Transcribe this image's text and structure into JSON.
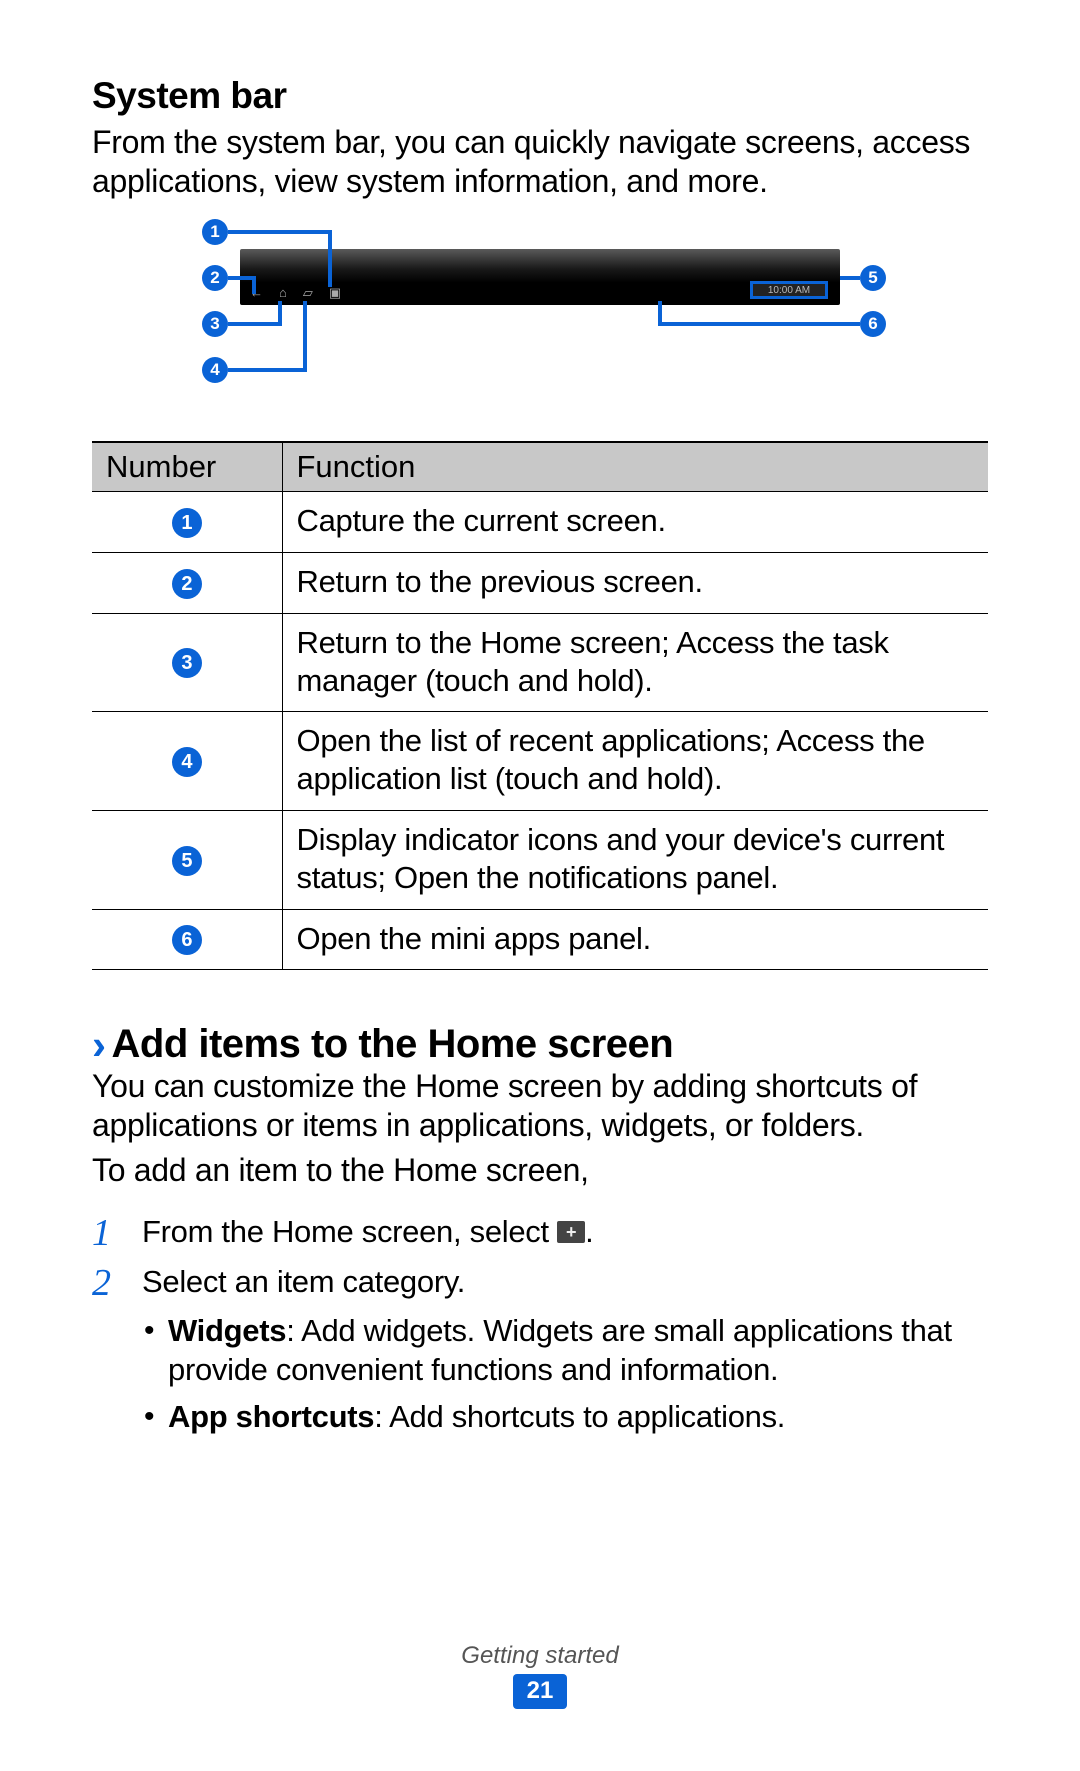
{
  "section1": {
    "title": "System bar",
    "intro": "From the system bar, you can quickly navigate screens, access applications, view system information, and more."
  },
  "diagram": {
    "status_text": "10:00 AM",
    "callouts": [
      "1",
      "2",
      "3",
      "4",
      "5",
      "6"
    ]
  },
  "table": {
    "headers": {
      "number": "Number",
      "function": "Function"
    },
    "rows": [
      {
        "n": "1",
        "fn": "Capture the current screen."
      },
      {
        "n": "2",
        "fn": "Return to the previous screen."
      },
      {
        "n": "3",
        "fn": "Return to the Home screen; Access the task manager (touch and hold)."
      },
      {
        "n": "4",
        "fn": "Open the list of recent applications; Access the application list (touch and hold)."
      },
      {
        "n": "5",
        "fn": "Display indicator icons and your device's current status; Open the notifications panel."
      },
      {
        "n": "6",
        "fn": "Open the mini apps panel."
      }
    ]
  },
  "section2": {
    "title": "Add items to the Home screen",
    "intro": "You can customize the Home screen by adding shortcuts of applications or items in applications, widgets, or folders.",
    "lead": "To add an item to the Home screen,",
    "steps": {
      "s1_pre": "From the Home screen, select ",
      "s1_post": ".",
      "s2": "Select an item category.",
      "bullets": {
        "b1_label": "Widgets",
        "b1_text": ": Add widgets. Widgets are small applications that provide convenient functions and information.",
        "b2_label": "App shortcuts",
        "b2_text": ": Add shortcuts to applications."
      }
    }
  },
  "footer": {
    "chapter": "Getting started",
    "page": "21"
  }
}
